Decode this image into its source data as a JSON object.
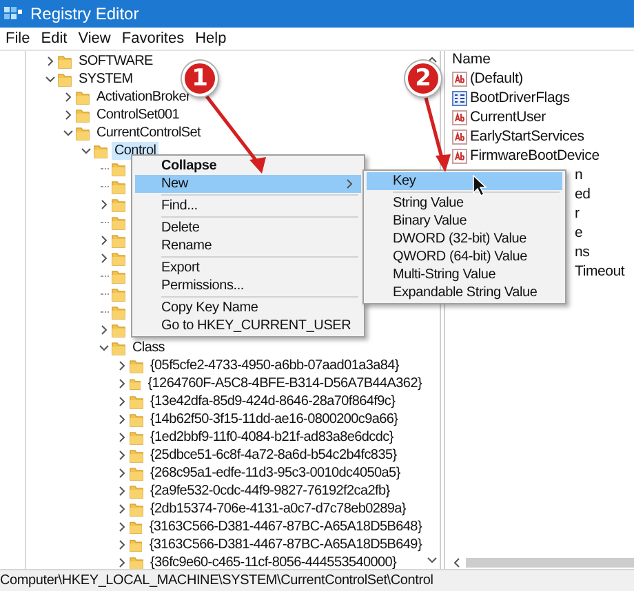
{
  "window": {
    "title": "Registry Editor"
  },
  "menu_bar": [
    {
      "label": "File"
    },
    {
      "label": "Edit"
    },
    {
      "label": "View"
    },
    {
      "label": "Favorites"
    },
    {
      "label": "Help"
    }
  ],
  "tree": [
    {
      "name": "SOFTWARE",
      "has_children": true,
      "expanded": false,
      "selected": false
    },
    {
      "name": "SYSTEM",
      "has_children": true,
      "expanded": true,
      "selected": false,
      "children": [
        {
          "name": "ActivationBroker",
          "has_children": true,
          "expanded": false,
          "selected": false
        },
        {
          "name": "ControlSet001",
          "has_children": true,
          "expanded": false,
          "selected": false
        },
        {
          "name": "CurrentControlSet",
          "has_children": true,
          "expanded": true,
          "selected": false,
          "children": [
            {
              "name": "Control",
              "has_children": true,
              "expanded": true,
              "selected": true,
              "children": [
                {
                  "has_children": false
                },
                {
                  "has_children": false
                },
                {
                  "has_children": true
                },
                {
                  "has_children": false
                },
                {
                  "has_children": true
                },
                {
                  "has_children": true
                },
                {
                  "has_children": false
                },
                {
                  "has_children": false
                },
                {
                  "has_children": false
                },
                {
                  "has_children": true
                },
                {
                  "name": "Class",
                  "has_children": true,
                  "expanded": true,
                  "selected": false,
                  "children": [
                    {
                      "name": "{05f5cfe2-4733-4950-a6bb-07aad01a3a84}",
                      "has_children": true,
                      "expanded": false,
                      "selected": false
                    },
                    {
                      "name": "{1264760F-A5C8-4BFE-B314-D56A7B44A362}",
                      "has_children": true,
                      "expanded": false,
                      "selected": false
                    },
                    {
                      "name": "{13e42dfa-85d9-424d-8646-28a70f864f9c}",
                      "has_children": true,
                      "expanded": false,
                      "selected": false
                    },
                    {
                      "name": "{14b62f50-3f15-11dd-ae16-0800200c9a66}",
                      "has_children": true,
                      "expanded": false,
                      "selected": false
                    },
                    {
                      "name": "{1ed2bbf9-11f0-4084-b21f-ad83a8e6dcdc}",
                      "has_children": true,
                      "expanded": false,
                      "selected": false
                    },
                    {
                      "name": "{25dbce51-6c8f-4a72-8a6d-b54c2b4fc835}",
                      "has_children": true,
                      "expanded": false,
                      "selected": false
                    },
                    {
                      "name": "{268c95a1-edfe-11d3-95c3-0010dc4050a5}",
                      "has_children": true,
                      "expanded": false,
                      "selected": false
                    },
                    {
                      "name": "{2a9fe532-0cdc-44f9-9827-76192f2ca2fb}",
                      "has_children": true,
                      "expanded": false,
                      "selected": false
                    },
                    {
                      "name": "{2db15374-706e-4131-a0c7-d7c78eb0289a}",
                      "has_children": true,
                      "expanded": false,
                      "selected": false
                    },
                    {
                      "name": "{3163C566-D381-4467-87BC-A65A18D5B648}",
                      "has_children": true,
                      "expanded": false,
                      "selected": false
                    },
                    {
                      "name": "{3163C566-D381-4467-87BC-A65A18D5B649}",
                      "has_children": true,
                      "expanded": false,
                      "selected": false
                    },
                    {
                      "name": "{36fc9e60-c465-11cf-8056-444553540000}",
                      "has_children": true,
                      "expanded": false,
                      "selected": false
                    }
                  ]
                }
              ]
            }
          ]
        }
      ]
    }
  ],
  "values": {
    "column": "Name",
    "rows": [
      {
        "kind": "string",
        "name": "(Default)"
      },
      {
        "kind": "binary",
        "name": "BootDriverFlags"
      },
      {
        "kind": "string",
        "name": "CurrentUser"
      },
      {
        "kind": "string",
        "name": "EarlyStartServices"
      },
      {
        "kind": "string",
        "name": "FirmwareBootDevice"
      },
      {
        "kind": "covered",
        "name": "n"
      },
      {
        "kind": "covered",
        "name": "ed"
      },
      {
        "kind": "covered",
        "name": "r"
      },
      {
        "kind": "covered",
        "name": "e"
      },
      {
        "kind": "covered",
        "name": "ns"
      },
      {
        "kind": "covered",
        "name": "Timeout"
      }
    ]
  },
  "context_menu": [
    {
      "kind": "item",
      "label": "Collapse",
      "default": true,
      "selected": false,
      "has_submenu": false
    },
    {
      "kind": "item",
      "label": "New",
      "default": false,
      "selected": true,
      "has_submenu": true
    },
    {
      "kind": "separator"
    },
    {
      "kind": "item",
      "label": "Find...",
      "default": false,
      "selected": false,
      "has_submenu": false
    },
    {
      "kind": "separator"
    },
    {
      "kind": "item",
      "label": "Delete",
      "default": false,
      "selected": false,
      "has_submenu": false
    },
    {
      "kind": "item",
      "label": "Rename",
      "default": false,
      "selected": false,
      "has_submenu": false
    },
    {
      "kind": "separator"
    },
    {
      "kind": "item",
      "label": "Export",
      "default": false,
      "selected": false,
      "has_submenu": false
    },
    {
      "kind": "item",
      "label": "Permissions...",
      "default": false,
      "selected": false,
      "has_submenu": false
    },
    {
      "kind": "separator"
    },
    {
      "kind": "item",
      "label": "Copy Key Name",
      "default": false,
      "selected": false,
      "has_submenu": false
    },
    {
      "kind": "item",
      "label": "Go to HKEY_CURRENT_USER",
      "default": false,
      "selected": false,
      "has_submenu": false
    }
  ],
  "submenu": [
    {
      "kind": "item",
      "label": "Key",
      "selected": true
    },
    {
      "kind": "separator"
    },
    {
      "kind": "item",
      "label": "String Value",
      "selected": false
    },
    {
      "kind": "item",
      "label": "Binary Value",
      "selected": false
    },
    {
      "kind": "item",
      "label": "DWORD (32-bit) Value",
      "selected": false
    },
    {
      "kind": "item",
      "label": "QWORD (64-bit) Value",
      "selected": false
    },
    {
      "kind": "item",
      "label": "Multi-String Value",
      "selected": false
    },
    {
      "kind": "item",
      "label": "Expandable String Value",
      "selected": false
    }
  ],
  "annotations": [
    {
      "label": "1"
    },
    {
      "label": "2"
    }
  ],
  "status_bar": "Computer\\HKEY_LOCAL_MACHINE\\SYSTEM\\CurrentControlSet\\Control"
}
